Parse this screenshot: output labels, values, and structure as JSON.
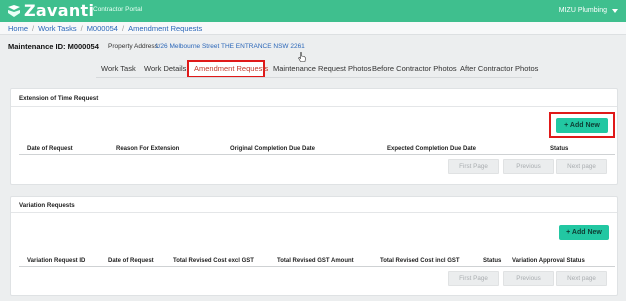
{
  "header": {
    "logo_text": "Zavanti",
    "portal_label": "Contractor Portal",
    "company": "MIZU Plumbing",
    "colors": {
      "brand": "#3fbf8e",
      "accent": "#22c7a2",
      "link": "#2a66b8",
      "highlight": "#e01919"
    }
  },
  "breadcrumb": [
    "Home",
    "Work Tasks",
    "M000054",
    "Amendment Requests"
  ],
  "page": {
    "maintenance_id": "Maintenance ID: M000054",
    "address_label": "Property Address:",
    "address_value": "1/26 Melbourne Street THE ENTRANCE NSW 2261"
  },
  "tabs": [
    {
      "label": "Work Task",
      "active": false
    },
    {
      "label": "Work Details",
      "active": false
    },
    {
      "label": "Amendment Requests",
      "active": true
    },
    {
      "label": "Maintenance Request Photos",
      "active": false
    },
    {
      "label": "Before Contractor Photos",
      "active": false
    },
    {
      "label": "After Contractor Photos",
      "active": false
    }
  ],
  "extension": {
    "title": "Extension of Time Request",
    "add_label": "+ Add New",
    "columns": [
      "Date of Request",
      "Reason For Extension",
      "Original Completion Due Date",
      "Expected Completion Due Date",
      "Status"
    ],
    "pagination": [
      "First Page",
      "Previous",
      "Next page"
    ]
  },
  "variation": {
    "title": "Variation Requests",
    "add_label": "+ Add New",
    "columns": [
      "Variation Request ID",
      "Date of Request",
      "Total Revised Cost excl GST",
      "Total Revised GST Amount",
      "Total Revised Cost incl GST",
      "Status",
      "Variation Approval Status"
    ],
    "pagination": [
      "First Page",
      "Previous",
      "Next page"
    ]
  }
}
